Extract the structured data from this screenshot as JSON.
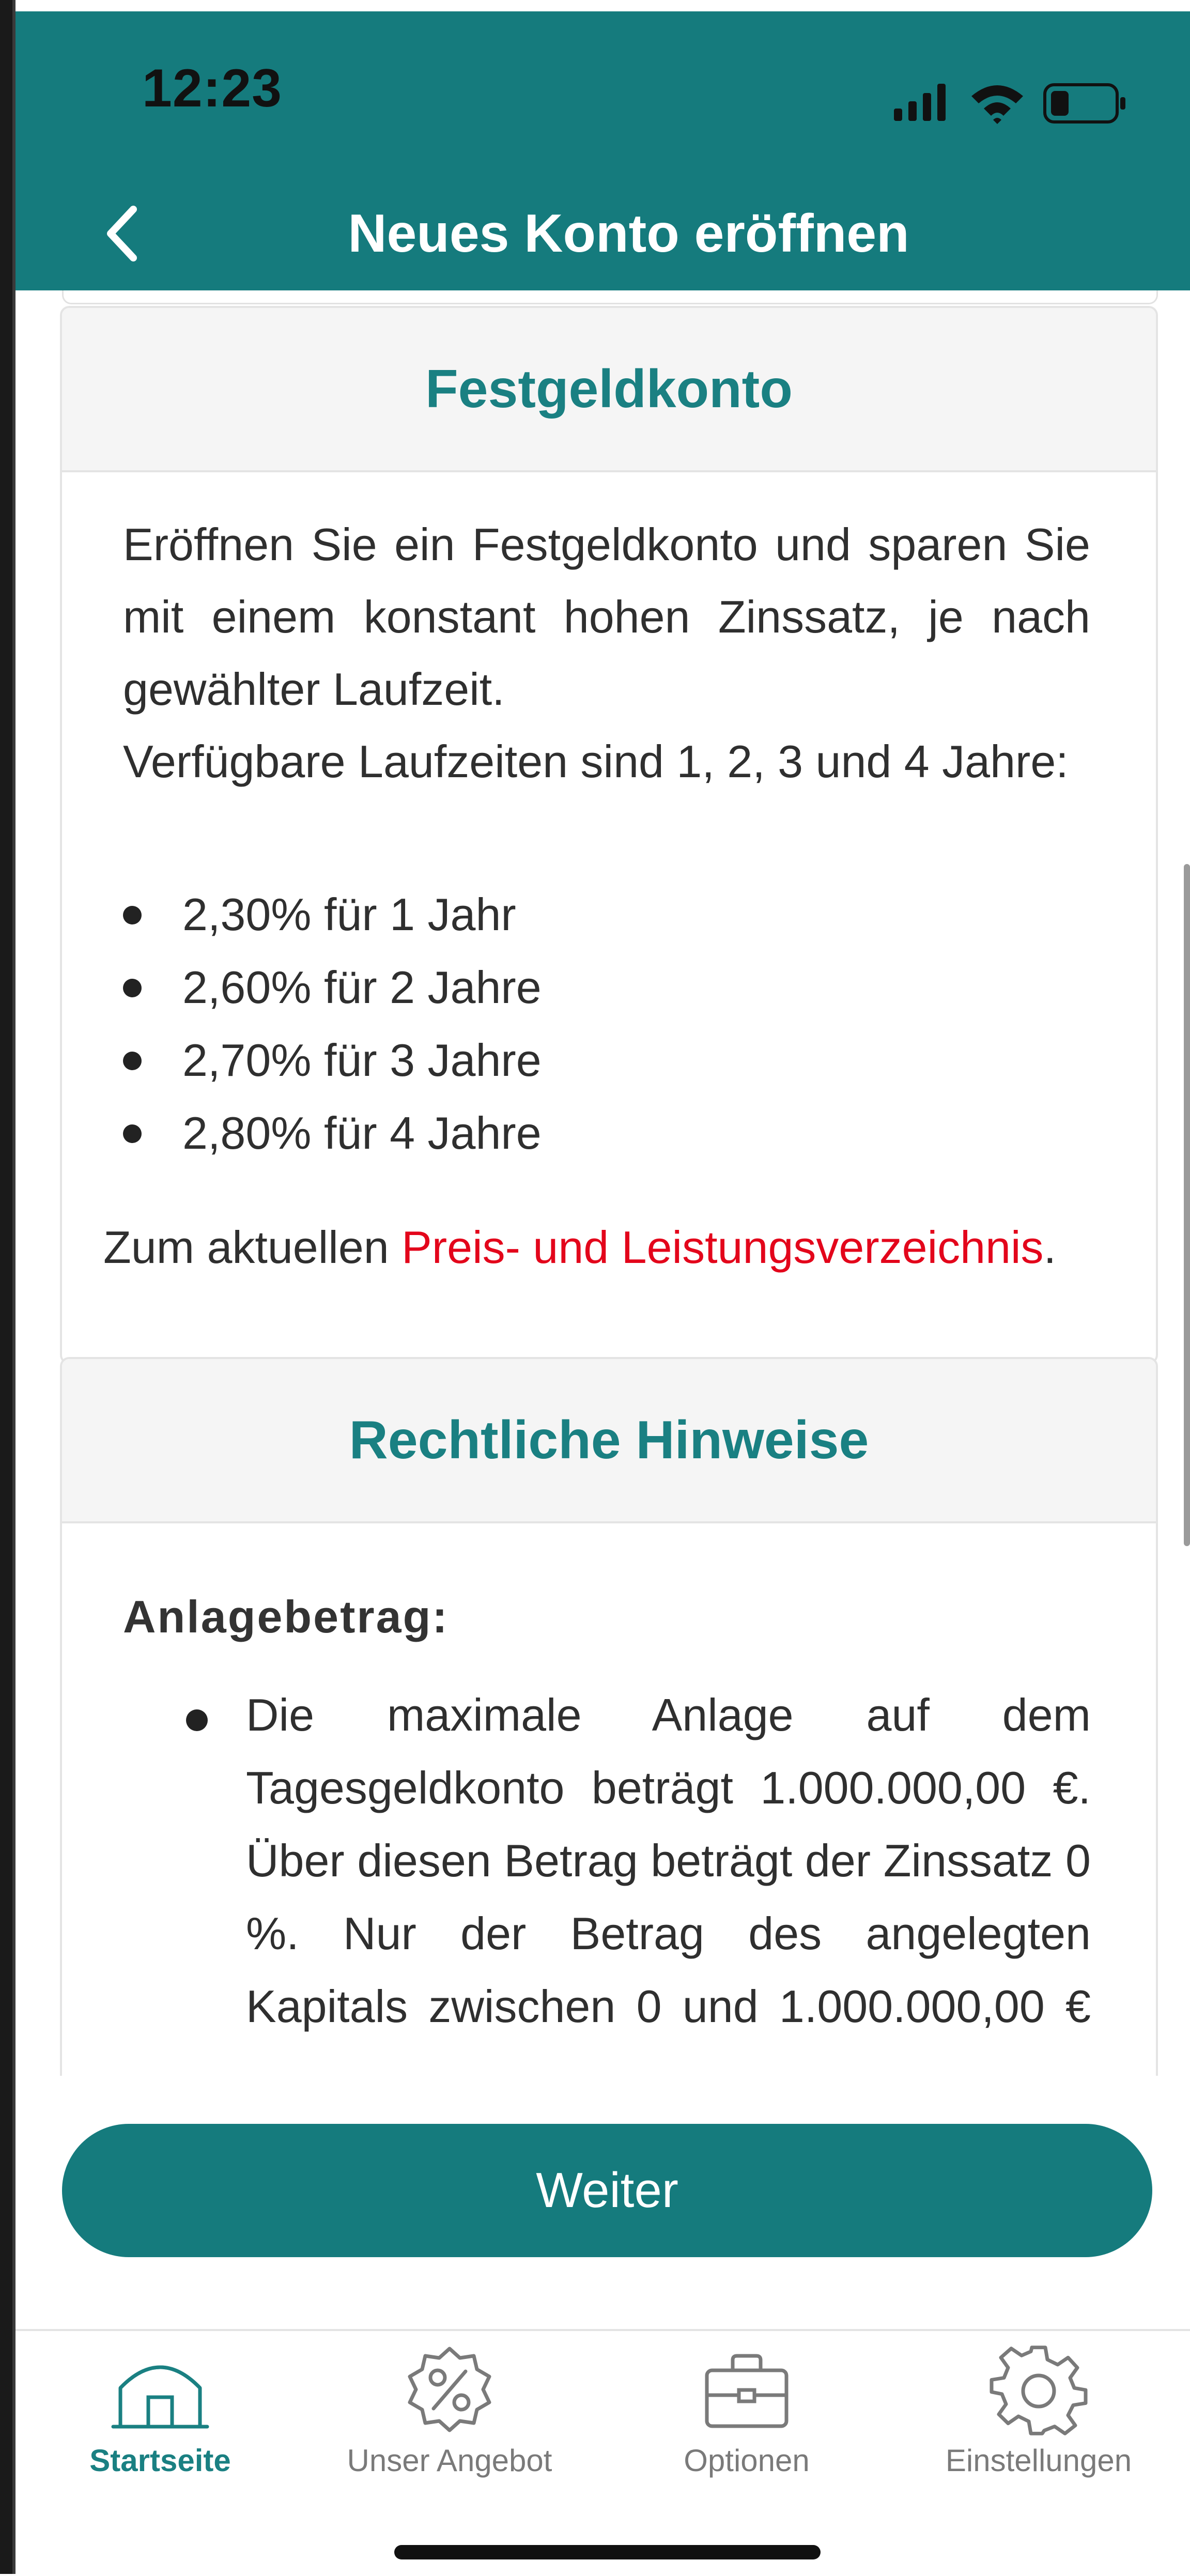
{
  "status_bar": {
    "time": "12:23"
  },
  "header": {
    "title": "Neues Konto eröffnen"
  },
  "card_festgeld": {
    "title": "Festgeldkonto",
    "description_lines": [
      "Eröffnen Sie ein Festgeldkonto und sparen Sie",
      "mit einem konstant hohen Zinssatz, je nach",
      "gewählter Laufzeit."
    ],
    "available_terms": "Verfügbare Laufzeiten sind 1, 2, 3 und 4 Jahre:",
    "rates": [
      "2,30% für 1 Jahr",
      "2,60% für 2 Jahre",
      "2,70% für 3 Jahre",
      "2,80% für 4 Jahre"
    ],
    "link_prefix": "Zum aktuellen ",
    "link_text": "Preis- und Leistungsverzeichnis",
    "link_suffix": "."
  },
  "card_legal": {
    "title": "Rechtliche Hinweise",
    "subheading": "Anlagebetrag:",
    "bullet_lines": [
      "Die maximale Anlage auf dem",
      "Tagesgeldkonto beträgt 1.000.000,00 €.",
      "Über diesen Betrag beträgt der Zinssatz 0",
      "%. Nur der Betrag des angelegten",
      "Kapitals zwischen 0 und 1.000.000,00 €"
    ]
  },
  "primary_button": {
    "label": "Weiter"
  },
  "tabbar": {
    "items": [
      {
        "label": "Startseite",
        "icon": "home-icon",
        "active": true
      },
      {
        "label": "Unser Angebot",
        "icon": "percent-badge-icon",
        "active": false
      },
      {
        "label": "Optionen",
        "icon": "briefcase-icon",
        "active": false
      },
      {
        "label": "Einstellungen",
        "icon": "gear-icon",
        "active": false
      }
    ]
  },
  "colors": {
    "brand": "#157b7d",
    "accent_text": "#1a8082",
    "link": "#e3051b"
  }
}
